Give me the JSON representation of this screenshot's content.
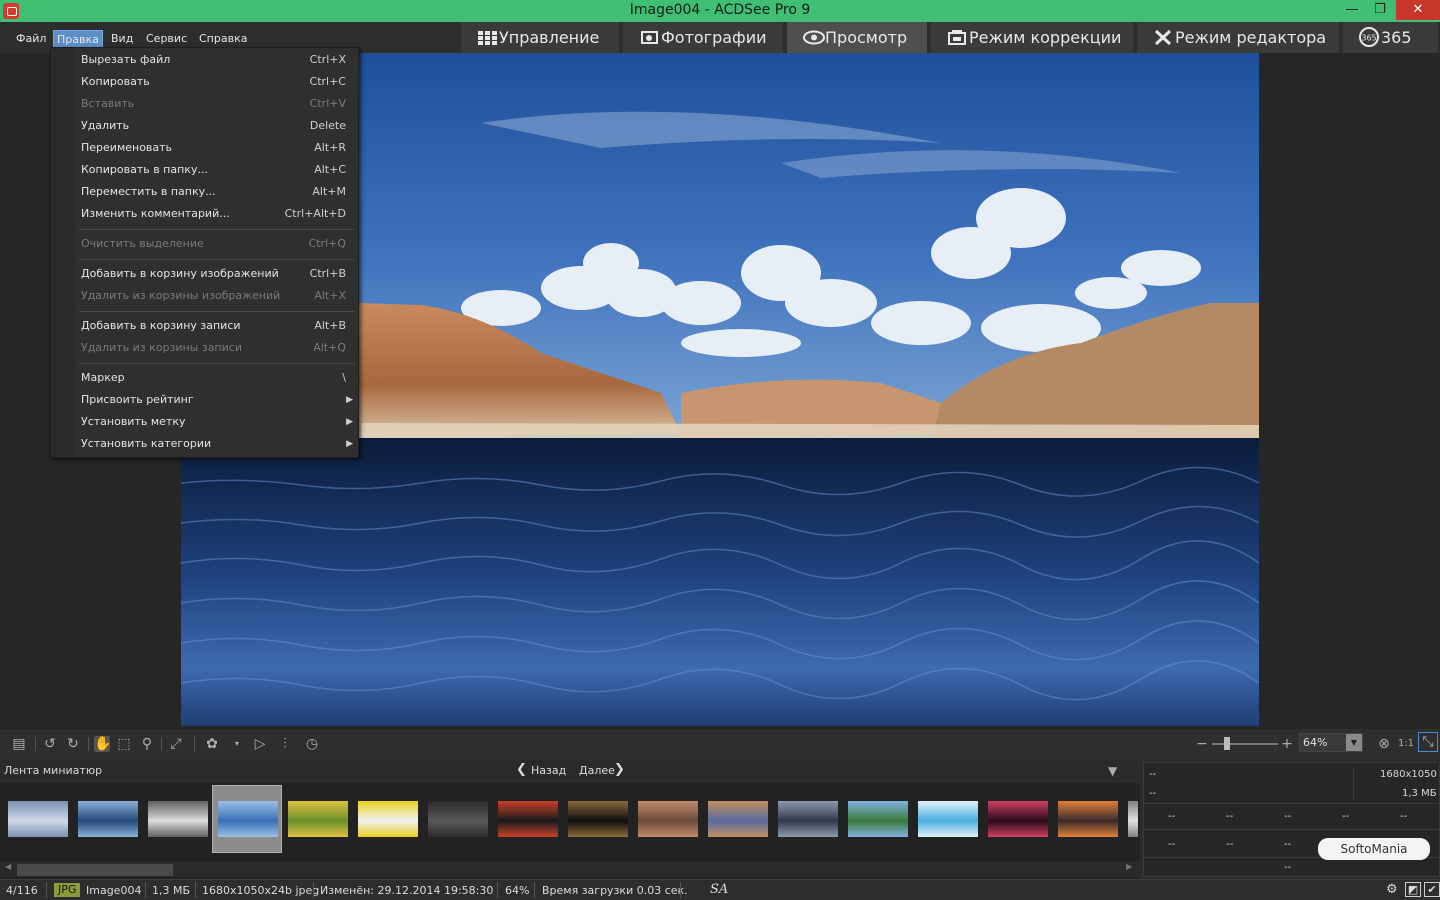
{
  "window": {
    "title": "Image004 - ACDSee Pro 9",
    "restore_glyph": "❐",
    "minimize_glyph": "—",
    "close_glyph": "✕"
  },
  "menubar": {
    "items": [
      "Файл",
      "Правка",
      "Вид",
      "Сервис",
      "Справка"
    ]
  },
  "mode_tabs": [
    {
      "label": "Управление",
      "icon": "grid-icon"
    },
    {
      "label": "Фотографии",
      "icon": "photos-icon"
    },
    {
      "label": "Просмотр",
      "icon": "eye-icon"
    },
    {
      "label": "Режим коррекции",
      "icon": "develop-icon"
    },
    {
      "label": "Режим редактора",
      "icon": "edit-tools-icon"
    },
    {
      "label": "365",
      "icon": "badge-365-icon"
    }
  ],
  "edit_menu": {
    "items": [
      {
        "label": "Вырезать файл",
        "shortcut": "Ctrl+X",
        "disabled": false
      },
      {
        "label": "Копировать",
        "shortcut": "Ctrl+C",
        "disabled": false
      },
      {
        "label": "Вставить",
        "shortcut": "Ctrl+V",
        "disabled": true
      },
      {
        "label": "Удалить",
        "shortcut": "Delete",
        "disabled": false
      },
      {
        "label": "Переименовать",
        "shortcut": "Alt+R",
        "disabled": false
      },
      {
        "label": "Копировать в папку...",
        "shortcut": "Alt+C",
        "disabled": false
      },
      {
        "label": "Переместить в папку...",
        "shortcut": "Alt+M",
        "disabled": false
      },
      {
        "label": "Изменить комментарий...",
        "shortcut": "Ctrl+Alt+D",
        "disabled": false
      },
      {
        "label": "Очистить выделение",
        "shortcut": "Ctrl+Q",
        "disabled": true
      },
      {
        "label": "Добавить в корзину изображений",
        "shortcut": "Ctrl+B",
        "disabled": false
      },
      {
        "label": "Удалить из корзины изображений",
        "shortcut": "Alt+X",
        "disabled": true
      },
      {
        "label": "Добавить в корзину записи",
        "shortcut": "Alt+B",
        "disabled": false
      },
      {
        "label": "Удалить из корзины записи",
        "shortcut": "Alt+Q",
        "disabled": true
      },
      {
        "label": "Маркер",
        "shortcut": "\\",
        "disabled": false
      },
      {
        "label": "Присвоить рейтинг",
        "shortcut": "",
        "disabled": false,
        "submenu": true
      },
      {
        "label": "Установить метку",
        "shortcut": "",
        "disabled": false,
        "submenu": true
      },
      {
        "label": "Установить категории",
        "shortcut": "",
        "disabled": false,
        "submenu": true
      }
    ]
  },
  "toolbar": {
    "zoom_value": "64%",
    "zoom_ratio_label": "1:1"
  },
  "filmstrip": {
    "title": "Лента миниатюр",
    "back_label": "Назад",
    "next_label": "Далее"
  },
  "info_panel": {
    "row1_left": "--",
    "dimensions": "1680x1050",
    "row2_left": "--",
    "filesize": "1,3 МБ",
    "placeholder": "--"
  },
  "status_bar": {
    "position": "4/116",
    "format": "JPG",
    "filename": "Image004",
    "size": "1,3 МБ",
    "dimensions": "1680x1050x24b jpeg",
    "modified": "Изменён: 29.12.2014 19:58:30",
    "zoom": "64%",
    "load_time": "Время загрузки 0.03 сек.",
    "signature": "SA"
  },
  "watermark": "SoftoMania",
  "colors": {
    "titlebar": "#3fbf74",
    "menu_highlight": "#5b8fc9",
    "close_button": "#c7352b"
  }
}
